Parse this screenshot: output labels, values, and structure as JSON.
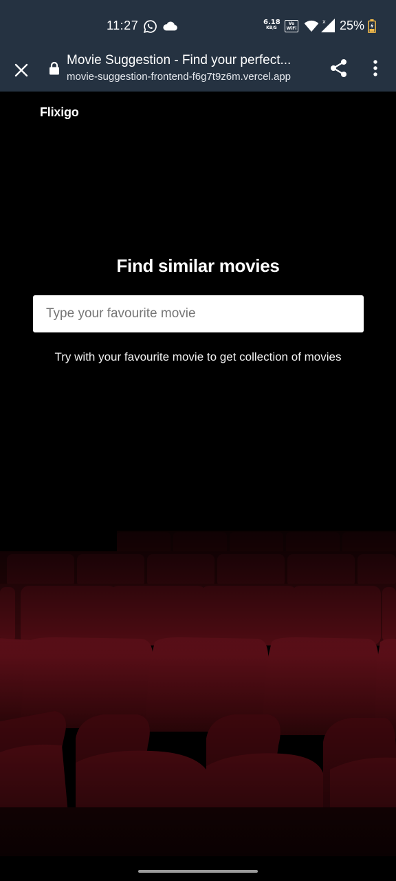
{
  "status_bar": {
    "time": "11:27",
    "net_speed_value": "6.18",
    "net_speed_unit": "KB/S",
    "volte_label": "Vo\nWiFi",
    "battery": "25%",
    "icons": [
      "whatsapp-icon",
      "cloud-icon",
      "wifi-icon",
      "signal-icon",
      "battery-icon"
    ]
  },
  "browser": {
    "title": "Movie Suggestion - Find your perfect...",
    "url": "movie-suggestion-frontend-f6g7t9z6m.vercel.app",
    "icons": [
      "close-icon",
      "lock-icon",
      "share-icon",
      "more-vert-icon"
    ]
  },
  "page": {
    "brand": "Flixigo",
    "heading": "Find similar movies",
    "search": {
      "placeholder": "Type your favourite movie",
      "value": ""
    },
    "hint": "Try with your favourite movie to get collection of movies"
  },
  "colors": {
    "chrome_bg": "#253241",
    "page_bg": "#000000",
    "seat_red": "#5a0c12"
  }
}
